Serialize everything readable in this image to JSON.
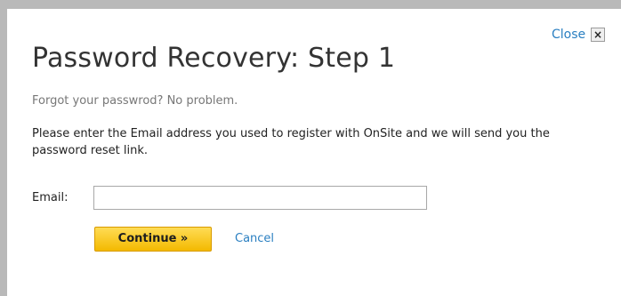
{
  "dialog": {
    "title": "Password Recovery: Step 1",
    "close_label": "Close",
    "close_icon": "×",
    "subtitle": "Forgot your passwrod? No problem.",
    "instructions": "Please enter the Email address you used to register with OnSite and we will send you the password reset link.",
    "form": {
      "email_label": "Email:",
      "email_value": "",
      "email_placeholder": ""
    },
    "actions": {
      "continue_label": "Continue »",
      "cancel_label": "Cancel"
    }
  },
  "colors": {
    "link": "#2a7fc1",
    "button": "#f3b900",
    "backdrop": "#b9b9b9"
  }
}
